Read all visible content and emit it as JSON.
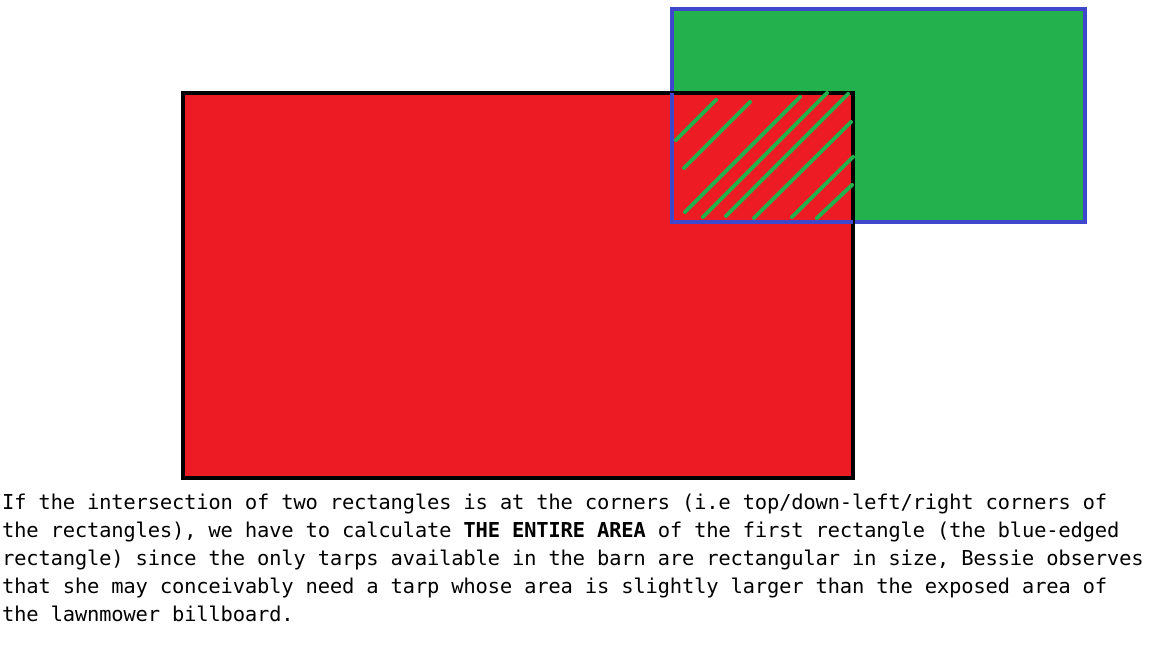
{
  "diagram": {
    "shapes": [
      {
        "id": "red-rectangle",
        "fill": "#ED1C24",
        "stroke": "#000000"
      },
      {
        "id": "green-rectangle",
        "fill": "#22B14C",
        "stroke": "#3F48CC"
      },
      {
        "id": "intersection-hatch",
        "stroke": "#22B14C"
      }
    ]
  },
  "caption": {
    "part1": "If the intersection of two rectangles is at the corners (i.e top/down-left/right corners of the rectangles), we have to calculate ",
    "emphasis": "THE ENTIRE AREA",
    "part2": " of the first rectangle (the blue-edged rectangle) since the only tarps available in the barn are rectangular in size, Bessie observes that she may conceivably need a tarp whose area is slightly larger than the exposed area of the lawnmower billboard."
  }
}
